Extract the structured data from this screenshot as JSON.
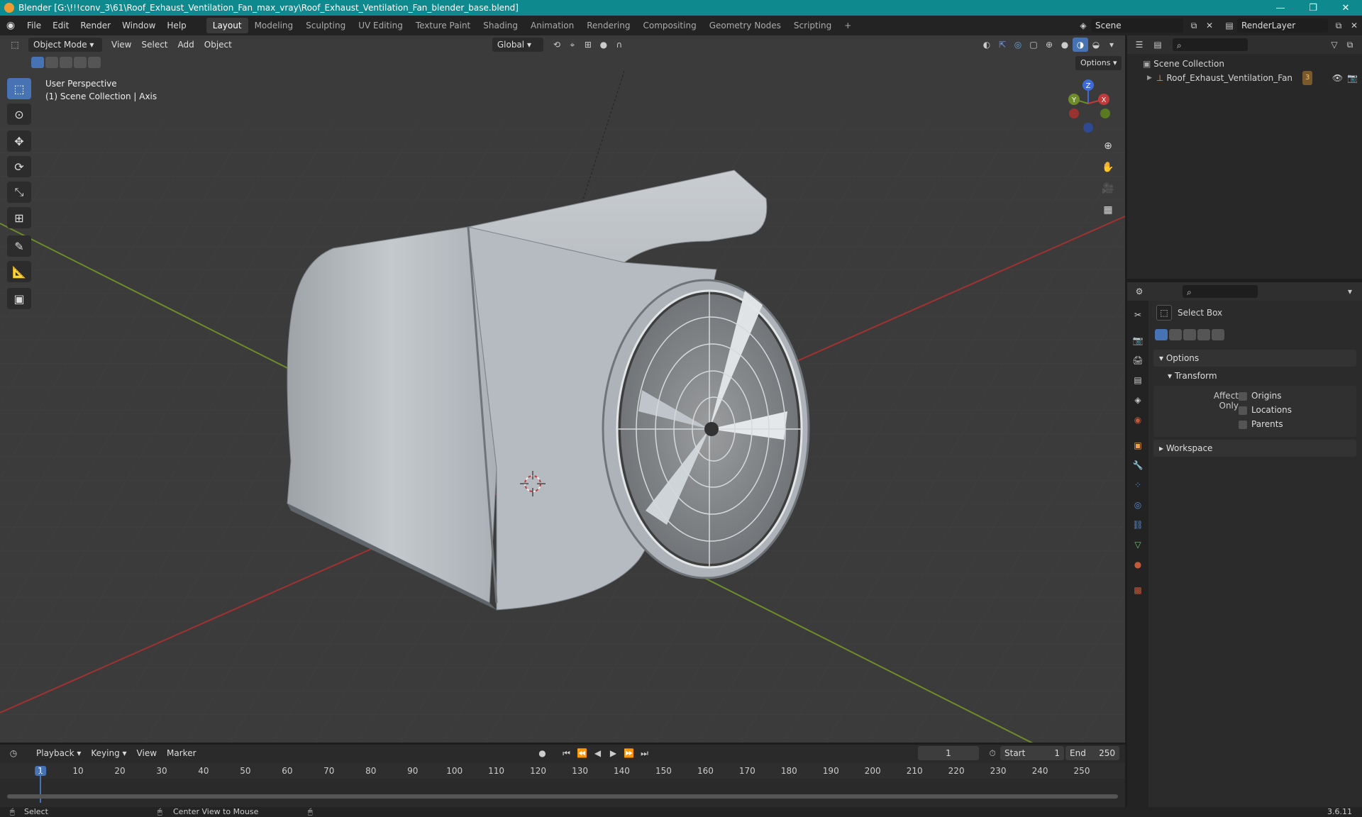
{
  "title_bar": {
    "title": "Blender [G:\\!!!conv_3\\61\\Roof_Exhaust_Ventilation_Fan_max_vray\\Roof_Exhaust_Ventilation_Fan_blender_base.blend]",
    "minimize": "—",
    "maximize": "❐",
    "close": "✕"
  },
  "menu": [
    "File",
    "Edit",
    "Render",
    "Window",
    "Help"
  ],
  "workspaces": [
    "Layout",
    "Modeling",
    "Sculpting",
    "UV Editing",
    "Texture Paint",
    "Shading",
    "Animation",
    "Rendering",
    "Compositing",
    "Geometry Nodes",
    "Scripting"
  ],
  "workspace_add": "+",
  "scene": {
    "name": "Scene"
  },
  "render_layer": {
    "name": "RenderLayer"
  },
  "viewport_header": {
    "mode": "Object Mode",
    "view": "View",
    "select": "Select",
    "add": "Add",
    "object": "Object",
    "orientation": "Global",
    "options": "Options"
  },
  "viewport_info": {
    "line1": "User Perspective",
    "line2": "(1) Scene Collection | Axis"
  },
  "gizmo": {
    "x": "X",
    "y": "Y",
    "z": "Z"
  },
  "outliner": {
    "collection": "Scene Collection",
    "object": "Roof_Exhaust_Ventilation_Fan",
    "object_badge": "3"
  },
  "properties": {
    "tool_name": "Select Box",
    "options_label": "Options",
    "transform_label": "Transform",
    "affect_only": "Affect Only",
    "checkboxes": [
      "Origins",
      "Locations",
      "Parents"
    ],
    "workspace_label": "Workspace"
  },
  "timeline": {
    "playback": "Playback",
    "keying": "Keying",
    "view": "View",
    "marker": "Marker",
    "current_frame": "1",
    "start_label": "Start",
    "start": "1",
    "end_label": "End",
    "end": "250",
    "ticks": [
      "1",
      "10",
      "20",
      "30",
      "40",
      "50",
      "60",
      "70",
      "80",
      "90",
      "100",
      "110",
      "120",
      "130",
      "140",
      "150",
      "160",
      "170",
      "180",
      "190",
      "200",
      "210",
      "220",
      "230",
      "240",
      "250"
    ]
  },
  "status": {
    "select": "Select",
    "center": "Center View to Mouse",
    "version": "3.6.11"
  },
  "colors": {
    "titlebar": "#0e8a8f",
    "accent": "#4772b3",
    "x_axis": "#a03232",
    "y_axis": "#6e8c2a",
    "viewport": "#3b3b3b"
  }
}
